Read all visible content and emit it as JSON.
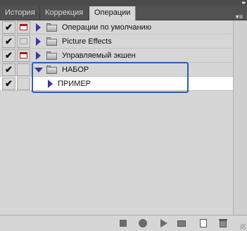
{
  "tabs": [
    {
      "label": "История"
    },
    {
      "label": "Коррекция"
    },
    {
      "label": "Операции"
    }
  ],
  "active_tab": "Операции",
  "rows": [
    {
      "label": "Операции по умолчанию",
      "checked": true,
      "dialog": "on",
      "expanded": false,
      "type": "set"
    },
    {
      "label": "Picture Effects",
      "checked": true,
      "dialog": "off",
      "expanded": false,
      "type": "set"
    },
    {
      "label": "Управляемый экшен",
      "checked": true,
      "dialog": "on",
      "expanded": false,
      "type": "set"
    },
    {
      "label": "НАБОР",
      "checked": true,
      "dialog": "none",
      "expanded": true,
      "type": "set"
    },
    {
      "label": "ПРИМЕР",
      "checked": true,
      "dialog": "none",
      "expanded": false,
      "type": "action",
      "selected": true
    }
  ],
  "icons": {
    "check": "✔",
    "panel_menu": "panel-menu-icon",
    "collapse": "collapse-icon"
  },
  "colors": {
    "highlight_border": "#2a5fa8",
    "dialog_red": "#b01818",
    "triangle_blue": "#3a3a9a"
  }
}
